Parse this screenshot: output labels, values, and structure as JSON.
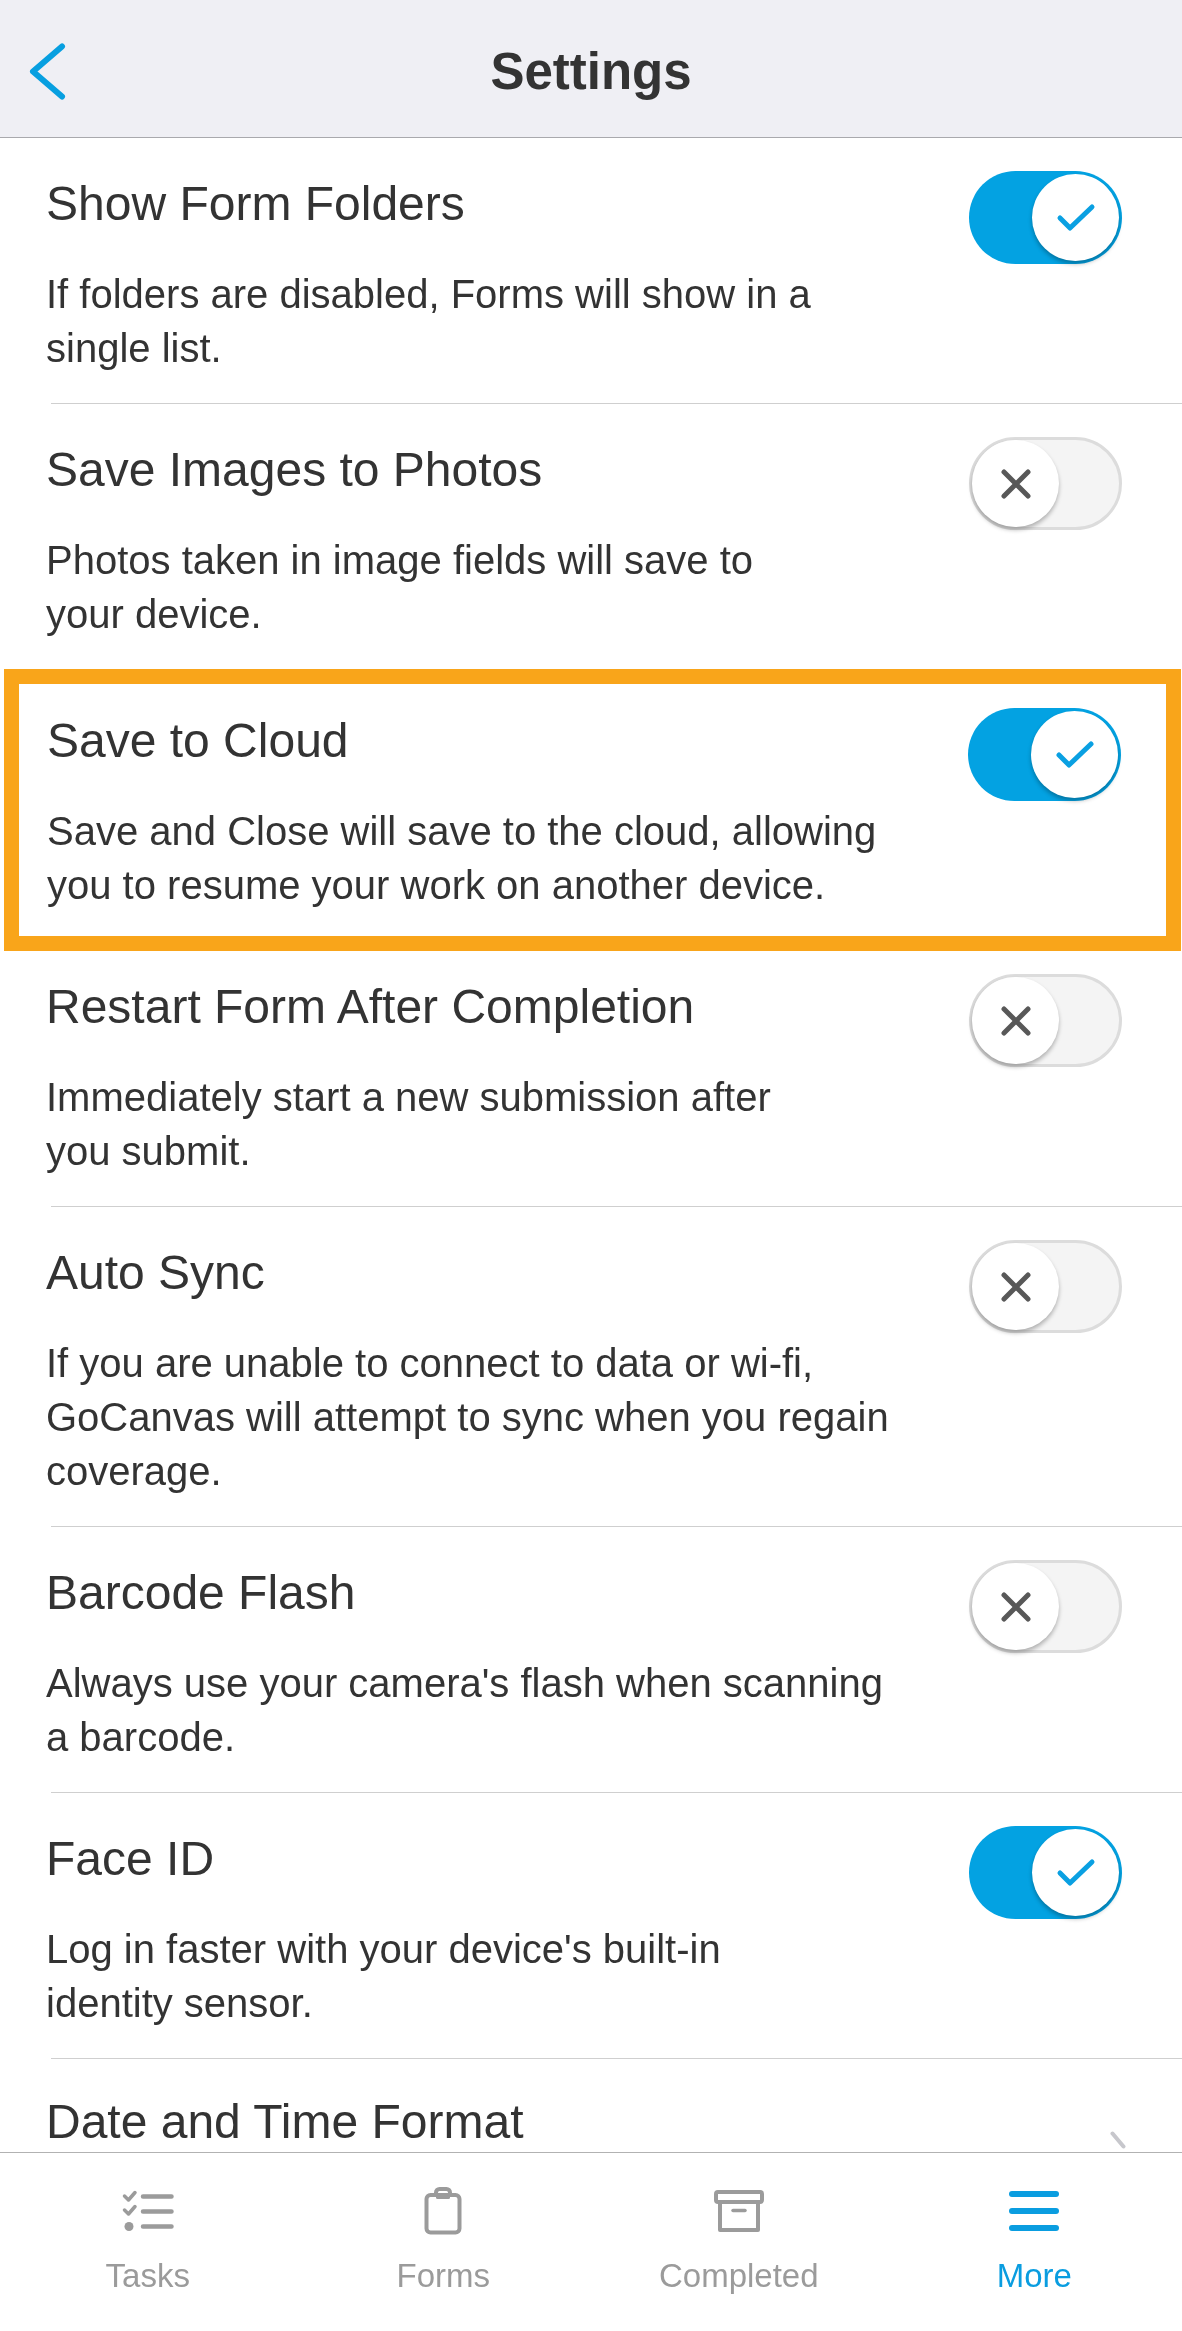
{
  "header": {
    "title": "Settings"
  },
  "settings": [
    {
      "kind": "toggle",
      "title": "Show Form Folders",
      "description": "If folders are disabled, Forms will show in a\nsingle list.",
      "on": true,
      "highlighted": false
    },
    {
      "kind": "toggle",
      "title": "Save Images to Photos",
      "description": "Photos taken in image fields will save to\nyour device.",
      "on": false,
      "highlighted": false
    },
    {
      "kind": "toggle",
      "title": "Save to Cloud",
      "description": "Save and Close will save to the cloud, allowing\nyou to resume your work on another device.",
      "on": true,
      "highlighted": true
    },
    {
      "kind": "toggle",
      "title": "Restart Form After Completion",
      "description": "Immediately start a new submission after\nyou submit.",
      "on": false,
      "highlighted": false
    },
    {
      "kind": "toggle",
      "title": "Auto Sync",
      "description": "If you are unable to connect to data or wi-fi,\nGoCanvas will attempt to sync when you regain\ncoverage.",
      "on": false,
      "highlighted": false
    },
    {
      "kind": "toggle",
      "title": "Barcode Flash",
      "description": "Always use your camera's flash when scanning\na barcode.",
      "on": false,
      "highlighted": false
    },
    {
      "kind": "toggle",
      "title": "Face ID",
      "description": "Log in faster with your device's built-in\nidentity sensor.",
      "on": true,
      "highlighted": false
    },
    {
      "kind": "link",
      "title": "Date and Time Format",
      "highlighted": false
    }
  ],
  "tab_bar": [
    {
      "label": "Tasks",
      "selected": false
    },
    {
      "label": "Forms",
      "selected": false
    },
    {
      "label": "Completed",
      "selected": false
    },
    {
      "label": "More",
      "selected": true
    }
  ]
}
